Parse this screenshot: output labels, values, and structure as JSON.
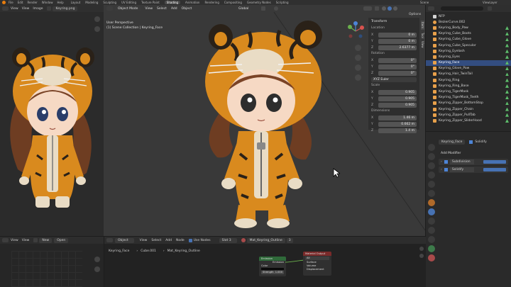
{
  "topbar": {
    "menus": [
      "File",
      "Edit",
      "Render",
      "Window",
      "Help"
    ],
    "workspaces": [
      "Layout",
      "Modeling",
      "Sculpting",
      "UV Editing",
      "Texture Paint",
      "Shading",
      "Animation",
      "Rendering",
      "Compositing",
      "Geometry Nodes",
      "Scripting"
    ],
    "active_workspace": "Shading",
    "scene_label": "Scene",
    "viewlayer_label": "ViewLayer"
  },
  "image_editor": {
    "menus": [
      "View",
      "View",
      "Image"
    ],
    "image_name": "Keyring.png"
  },
  "viewport": {
    "mode": "Object Mode",
    "menus": [
      "View",
      "Select",
      "Add",
      "Object"
    ],
    "transform_orientation": "Global",
    "info_line1": "User Perspective",
    "info_line2": "(1) Scene Collection | Keyring_Face",
    "options_label": "Options",
    "tabs": [
      "Item",
      "Tool",
      "View"
    ]
  },
  "transform_panel": {
    "title": "Transform",
    "location_label": "Location",
    "location": [
      {
        "axis": "X",
        "value": "0 m"
      },
      {
        "axis": "Y",
        "value": "0 m"
      },
      {
        "axis": "Z",
        "value": "2.6377 m"
      }
    ],
    "rotation_label": "Rotation",
    "rotation": [
      {
        "axis": "X",
        "value": "0°"
      },
      {
        "axis": "Y",
        "value": "0°"
      },
      {
        "axis": "Z",
        "value": "0°"
      }
    ],
    "rotation_mode": "XYZ Euler",
    "scale_label": "Scale",
    "scale": [
      {
        "axis": "X",
        "value": "0.905"
      },
      {
        "axis": "Y",
        "value": "0.905"
      },
      {
        "axis": "Z",
        "value": "0.905"
      }
    ],
    "dimensions_label": "Dimensions",
    "dimensions": [
      {
        "axis": "X",
        "value": "1.46 m"
      },
      {
        "axis": "Y",
        "value": "0.662 m"
      },
      {
        "axis": "Z",
        "value": "1.4 m"
      }
    ]
  },
  "outliner": {
    "items": [
      {
        "label": "NFP"
      },
      {
        "label": "BezierCurve.002"
      },
      {
        "label": "Keyring_Body_Paw"
      },
      {
        "label": "Keyring_Cube_Boots"
      },
      {
        "label": "Keyring_Cube_Glove"
      },
      {
        "label": "Keyring_Cube_Speculor"
      },
      {
        "label": "Keyring_Eyelash"
      },
      {
        "label": "Keyring_Eyes"
      },
      {
        "label": "Keyring_Face"
      },
      {
        "label": "Keyring_Glove_Paw"
      },
      {
        "label": "Keyring_Hair_TwinTail"
      },
      {
        "label": "Keyring_Ring"
      },
      {
        "label": "Keyring_Ring_Base"
      },
      {
        "label": "Keyring_TigerMask"
      },
      {
        "label": "Keyring_TigerMask_Teeth"
      },
      {
        "label": "Keyring_Zipper_BottomStop"
      },
      {
        "label": "Keyring_Zipper_Chain"
      },
      {
        "label": "Keyring_Zipper_PullTab"
      },
      {
        "label": "Keyring_Zipper_SliderHood"
      }
    ]
  },
  "properties": {
    "object_name": "Keyring_Face",
    "modifier_tag": "Solidify",
    "add_modifier_label": "Add Modifier",
    "modifiers": [
      {
        "name": "Subdivision"
      },
      {
        "name": "Solidify"
      }
    ]
  },
  "node_editor": {
    "object_dropdown": "Object",
    "menus": [
      "View",
      "Select",
      "Add",
      "Node"
    ],
    "use_nodes_label": "Use Nodes",
    "slot_label": "Slot 3",
    "material_name": "Mat_Keyring_Outline",
    "material_users": "3",
    "breadcrumb": [
      "Keyring_Face",
      "Cube.001",
      "Mat_Keyring_Outline"
    ],
    "emission_node": {
      "title": "Emission",
      "output": "Emission",
      "color_label": "Color",
      "strength_label": "Strength",
      "strength_value": "1.000"
    },
    "output_node": {
      "title": "Material Output",
      "target": "All",
      "sockets": [
        "Surface",
        "Volume",
        "Displacement"
      ]
    }
  },
  "bottom_left": {
    "menus": [
      "View",
      "View"
    ],
    "new_label": "New",
    "open_label": "Open"
  },
  "colors": {
    "accent": "#4772b3",
    "orange_icon": "#e8a04a",
    "green_icon": "#5dbd6b"
  }
}
